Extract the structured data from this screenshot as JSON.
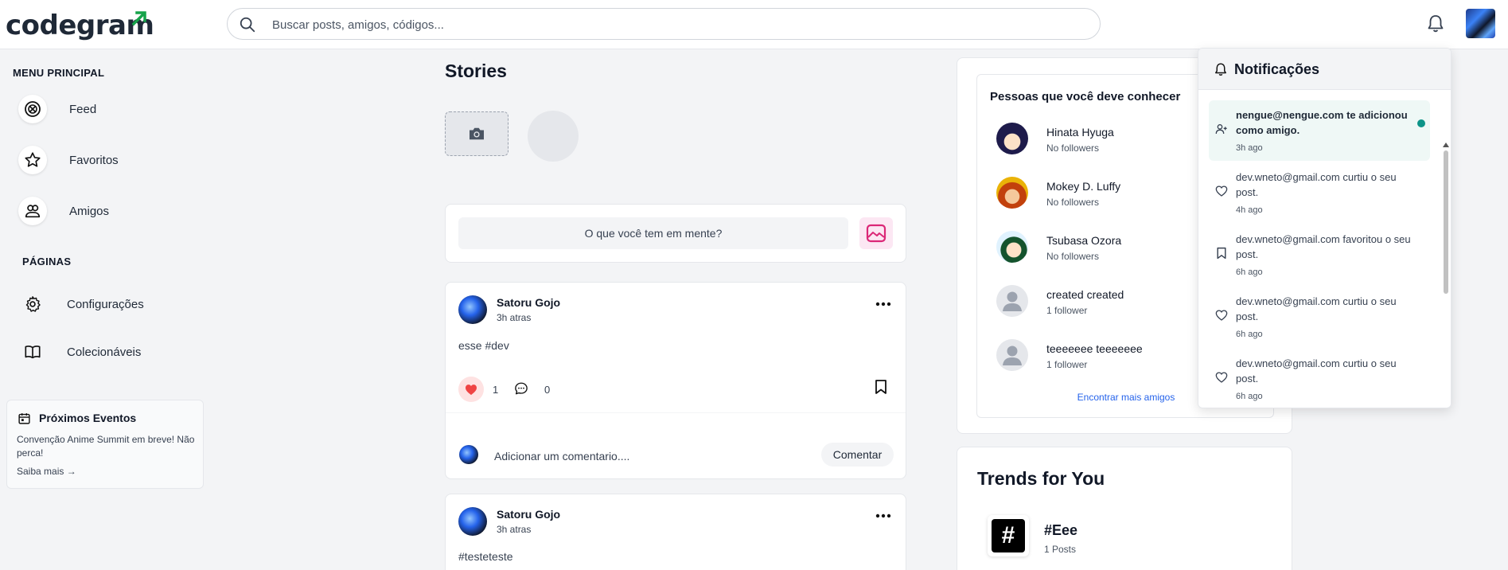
{
  "header": {
    "logo": "codegram",
    "search_placeholder": "Buscar posts, amigos, códigos..."
  },
  "sidebar": {
    "main_menu_title": "MENU PRINCIPAL",
    "items": [
      {
        "label": "Feed",
        "icon": "feed-icon"
      },
      {
        "label": "Favoritos",
        "icon": "star-icon"
      },
      {
        "label": "Amigos",
        "icon": "friends-icon"
      }
    ],
    "pages_title": "PÁGINAS",
    "pages": [
      {
        "label": "Configurações",
        "icon": "gear-icon"
      },
      {
        "label": "Colecionáveis",
        "icon": "book-icon"
      }
    ],
    "events": {
      "title": "Próximos Eventos",
      "description": "Convenção Anime Summit em breve! Não perca!",
      "link": "Saiba mais →"
    }
  },
  "feed": {
    "stories_title": "Stories",
    "composer_placeholder": "O que você tem em mente?",
    "posts": [
      {
        "author": "Satoru Gojo",
        "time": "3h atras",
        "body": "esse #dev",
        "likes": "1",
        "comments": "0",
        "comment_placeholder": "Adicionar um comentario....",
        "comment_button": "Comentar"
      },
      {
        "author": "Satoru Gojo",
        "time": "3h atras",
        "body": "#testeteste"
      }
    ]
  },
  "suggestions": {
    "title": "Pessoas que você deve conhecer",
    "people": [
      {
        "name": "Hinata Hyuga",
        "followers": "No followers"
      },
      {
        "name": "Mokey D. Luffy",
        "followers": "No followers"
      },
      {
        "name": "Tsubasa Ozora",
        "followers": "No followers"
      },
      {
        "name": "created created",
        "followers": "1 follower"
      },
      {
        "name": "teeeeeee teeeeeee",
        "followers": "1 follower"
      }
    ],
    "more_link": "Encontrar mais amigos"
  },
  "trends": {
    "title": "Trends for You",
    "items": [
      {
        "tag": "#Eee",
        "posts": "1 Posts",
        "symbol": "#"
      }
    ]
  },
  "notifications": {
    "title": "Notificações",
    "items": [
      {
        "text": "nengue@nengue.com te adicionou como amigo.",
        "time": "3h ago",
        "icon": "user-add-icon",
        "unread": true
      },
      {
        "text": "dev.wneto@gmail.com curtiu o seu post.",
        "time": "4h ago",
        "icon": "heart-icon",
        "unread": false
      },
      {
        "text": "dev.wneto@gmail.com favoritou o seu post.",
        "time": "6h ago",
        "icon": "bookmark-icon",
        "unread": false
      },
      {
        "text": "dev.wneto@gmail.com curtiu o seu post.",
        "time": "6h ago",
        "icon": "heart-icon",
        "unread": false
      },
      {
        "text": "dev.wneto@gmail.com curtiu o seu post.",
        "time": "6h ago",
        "icon": "heart-icon",
        "unread": false
      }
    ]
  },
  "colors": {
    "brand_green": "#16a34a",
    "like_red": "#ef4444",
    "notif_dot": "#0d9488",
    "link_blue": "#2563eb"
  }
}
